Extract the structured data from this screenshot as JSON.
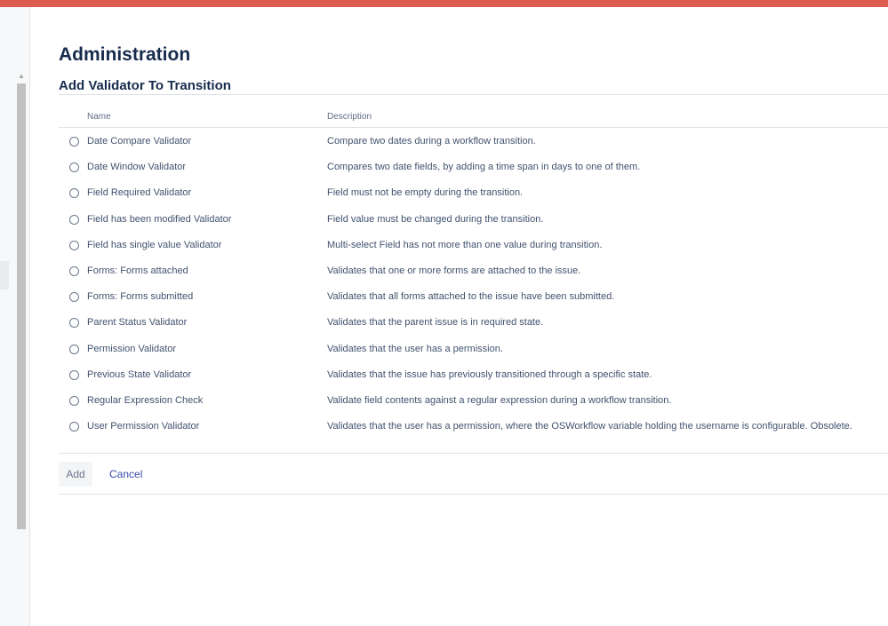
{
  "page": {
    "title": "Administration",
    "section_title": "Add Validator To Transition"
  },
  "table": {
    "headers": {
      "name": "Name",
      "description": "Description"
    },
    "rows": [
      {
        "name": "Date Compare Validator",
        "description": "Compare two dates during a workflow transition."
      },
      {
        "name": "Date Window Validator",
        "description": "Compares two date fields, by adding a time span in days to one of them."
      },
      {
        "name": "Field Required Validator",
        "description": "Field must not be empty during the transition."
      },
      {
        "name": "Field has been modified Validator",
        "description": "Field value must be changed during the transition."
      },
      {
        "name": "Field has single value Validator",
        "description": "Multi-select Field has not more than one value during transition."
      },
      {
        "name": "Forms: Forms attached",
        "description": "Validates that one or more forms are attached to the issue."
      },
      {
        "name": "Forms: Forms submitted",
        "description": "Validates that all forms attached to the issue have been submitted."
      },
      {
        "name": "Parent Status Validator",
        "description": "Validates that the parent issue is in required state."
      },
      {
        "name": "Permission Validator",
        "description": "Validates that the user has a permission."
      },
      {
        "name": "Previous State Validator",
        "description": "Validates that the issue has previously transitioned through a specific state."
      },
      {
        "name": "Regular Expression Check",
        "description": "Validate field contents against a regular expression during a workflow transition."
      },
      {
        "name": "User Permission Validator",
        "description": "Validates that the user has a permission, where the OSWorkflow variable holding the username is configurable. Obsolete."
      }
    ]
  },
  "actions": {
    "add_label": "Add",
    "cancel_label": "Cancel"
  },
  "colors": {
    "topbar": "#de5b52",
    "link": "#3a4aa8",
    "heading": "#172b4d"
  }
}
